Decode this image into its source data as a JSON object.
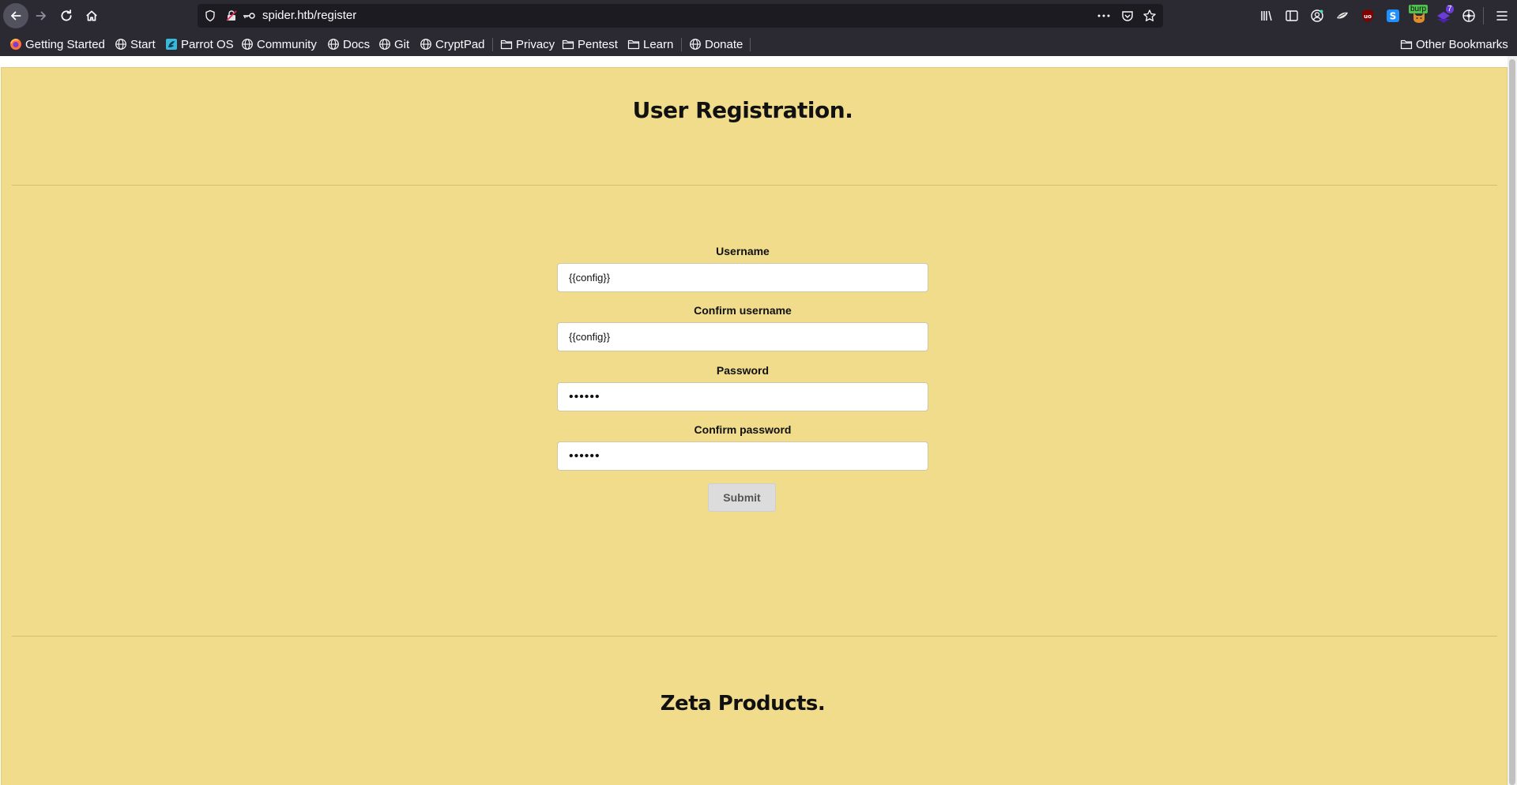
{
  "browser": {
    "url": "spider.htb/register",
    "bookmarks": [
      {
        "label": "Getting Started",
        "icon": "firefox-icon"
      },
      {
        "label": "Start",
        "icon": "globe-icon"
      },
      {
        "label": "Parrot OS",
        "icon": "parrot-icon"
      },
      {
        "label": "Community",
        "icon": "globe-icon"
      },
      {
        "label": "Docs",
        "icon": "globe-icon"
      },
      {
        "label": "Git",
        "icon": "globe-icon"
      },
      {
        "label": "CryptPad",
        "icon": "globe-icon"
      },
      {
        "label": "Privacy",
        "icon": "folder-icon"
      },
      {
        "label": "Pentest",
        "icon": "folder-icon"
      },
      {
        "label": "Learn",
        "icon": "folder-icon"
      },
      {
        "label": "Donate",
        "icon": "globe-icon"
      }
    ],
    "other_bookmarks": "Other Bookmarks",
    "burp_badge": "burp",
    "ext_badge_count": "7"
  },
  "page": {
    "title": "User Registration.",
    "form": {
      "username_label": "Username",
      "username_value": "{{config}}",
      "confirm_username_label": "Confirm username",
      "confirm_username_value": "{{config}}",
      "password_label": "Password",
      "password_value": "••••••",
      "confirm_password_label": "Confirm password",
      "confirm_password_value": "••••••",
      "submit_label": "Submit"
    },
    "footer_title": "Zeta Products."
  },
  "colors": {
    "page_background": "#f0dc8a",
    "browser_chrome": "#2b2a33",
    "urlbar": "#1c1b22"
  }
}
